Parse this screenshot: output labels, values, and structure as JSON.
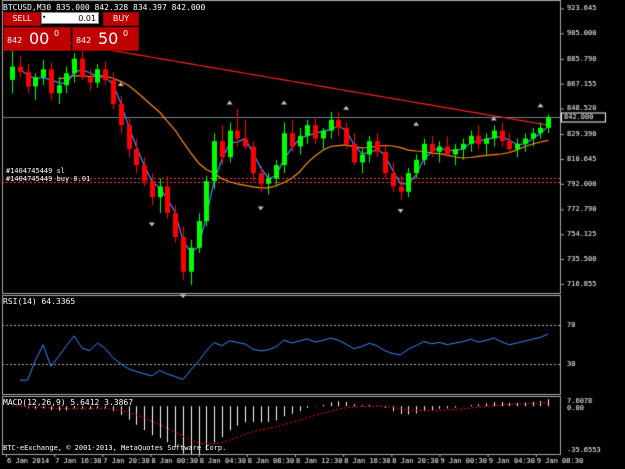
{
  "header": {
    "title": "BTCUSD,M30  835.000 842.328 834.397 842.000",
    "rsi_title": "RSI(14) 64.3365",
    "macd_title": "MACD(12,26,9) 5.6412 3.3867",
    "copyright": "BTC-eExchange, © 2001-2013, MetaQuotes Software Corp."
  },
  "oneclick": {
    "sell_label": "SELL",
    "buy_label": "BUY",
    "lot": "0.01",
    "sell_small": "842",
    "sell_big": "00",
    "sell_sup": "0",
    "buy_small": "842",
    "buy_big": "50",
    "buy_sup": "0"
  },
  "levels": {
    "sl_label": "#1404745449 sl",
    "buy_label": "#1404745449 buy 0.01",
    "sl_price": 796.5,
    "buy_price": 793.5,
    "current_price": 842.0,
    "current_label": "842.000"
  },
  "colors": {
    "bull": "#00ff00",
    "bear": "#ff0000",
    "ma_fast": "#4a90ff",
    "ma_mid": "#ff8c1a",
    "ma_slow": "#ff2020",
    "rsi": "#3a8cff",
    "level": "#ff4040",
    "grid_text": "#ffffff"
  },
  "chart_data": {
    "type": "candlestick",
    "title": "BTCUSD,M30",
    "price_ticks": [
      "923.645",
      "905.000",
      "885.790",
      "867.155",
      "848.520",
      "829.390",
      "810.645",
      "792.000",
      "772.790",
      "754.125",
      "735.500",
      "716.855"
    ],
    "price_tick_values": [
      923.645,
      905.0,
      885.79,
      867.155,
      848.52,
      829.39,
      810.645,
      792.0,
      772.79,
      754.125,
      735.5,
      716.855
    ],
    "ylim": [
      710,
      930
    ],
    "x_labels": [
      "6 Jan 2014",
      "7 Jan 16:30",
      "7 Jan 20:30",
      "8 Jan 00:30",
      "8 Jan 04:30",
      "8 Jan 08:30",
      "8 Jan 12:30",
      "8 Jan 16:30",
      "8 Jan 20:30",
      "9 Jan 00:30",
      "9 Jan 04:30",
      "9 Jan 08:30"
    ],
    "candles": [
      [
        870,
        895,
        860,
        880
      ],
      [
        880,
        888,
        872,
        876
      ],
      [
        876,
        882,
        860,
        865
      ],
      [
        865,
        875,
        855,
        872
      ],
      [
        872,
        885,
        866,
        878
      ],
      [
        878,
        883,
        855,
        860
      ],
      [
        860,
        872,
        852,
        866
      ],
      [
        866,
        880,
        860,
        875
      ],
      [
        875,
        890,
        868,
        886
      ],
      [
        886,
        892,
        870,
        872
      ],
      [
        872,
        878,
        862,
        868
      ],
      [
        868,
        882,
        864,
        878
      ],
      [
        878,
        884,
        866,
        870
      ],
      [
        870,
        876,
        848,
        852
      ],
      [
        852,
        858,
        830,
        836
      ],
      [
        836,
        842,
        812,
        818
      ],
      [
        818,
        826,
        800,
        806
      ],
      [
        806,
        812,
        790,
        794
      ],
      [
        794,
        800,
        776,
        782
      ],
      [
        782,
        796,
        770,
        790
      ],
      [
        790,
        798,
        766,
        770
      ],
      [
        770,
        776,
        748,
        752
      ],
      [
        752,
        760,
        720,
        726
      ],
      [
        726,
        750,
        716,
        744
      ],
      [
        744,
        770,
        740,
        764
      ],
      [
        764,
        798,
        760,
        794
      ],
      [
        794,
        830,
        788,
        824
      ],
      [
        824,
        836,
        806,
        812
      ],
      [
        812,
        838,
        808,
        832
      ],
      [
        832,
        848,
        820,
        826
      ],
      [
        826,
        840,
        818,
        820
      ],
      [
        820,
        824,
        794,
        800
      ],
      [
        800,
        806,
        786,
        792
      ],
      [
        792,
        800,
        784,
        796
      ],
      [
        796,
        810,
        790,
        806
      ],
      [
        806,
        838,
        800,
        830
      ],
      [
        830,
        840,
        816,
        820
      ],
      [
        820,
        834,
        814,
        828
      ],
      [
        828,
        840,
        822,
        836
      ],
      [
        836,
        842,
        822,
        826
      ],
      [
        826,
        834,
        818,
        832
      ],
      [
        832,
        846,
        826,
        840
      ],
      [
        840,
        846,
        828,
        834
      ],
      [
        834,
        838,
        818,
        822
      ],
      [
        822,
        830,
        806,
        808
      ],
      [
        808,
        818,
        800,
        814
      ],
      [
        814,
        828,
        808,
        824
      ],
      [
        824,
        830,
        812,
        816
      ],
      [
        816,
        820,
        796,
        800
      ],
      [
        800,
        808,
        786,
        790
      ],
      [
        790,
        798,
        780,
        786
      ],
      [
        786,
        804,
        782,
        800
      ],
      [
        800,
        814,
        796,
        810
      ],
      [
        810,
        826,
        806,
        822
      ],
      [
        822,
        828,
        812,
        816
      ],
      [
        816,
        824,
        808,
        820
      ],
      [
        820,
        828,
        812,
        814
      ],
      [
        814,
        822,
        806,
        818
      ],
      [
        818,
        826,
        810,
        822
      ],
      [
        822,
        832,
        816,
        828
      ],
      [
        828,
        836,
        818,
        822
      ],
      [
        822,
        830,
        814,
        826
      ],
      [
        826,
        836,
        820,
        832
      ],
      [
        832,
        838,
        820,
        824
      ],
      [
        824,
        830,
        816,
        818
      ],
      [
        818,
        826,
        812,
        822
      ],
      [
        822,
        830,
        816,
        826
      ],
      [
        826,
        834,
        820,
        830
      ],
      [
        830,
        838,
        826,
        834
      ],
      [
        834,
        844,
        830,
        842
      ]
    ],
    "rsi": {
      "levels": [
        70,
        30
      ],
      "level_labels": [
        "70",
        "30"
      ],
      "ylim": [
        0,
        100
      ]
    },
    "macd": {
      "tick_labels": [
        "7.6078",
        "0.00",
        "-35.6553"
      ],
      "ylim": [
        -35.6553,
        7.6078
      ]
    }
  }
}
